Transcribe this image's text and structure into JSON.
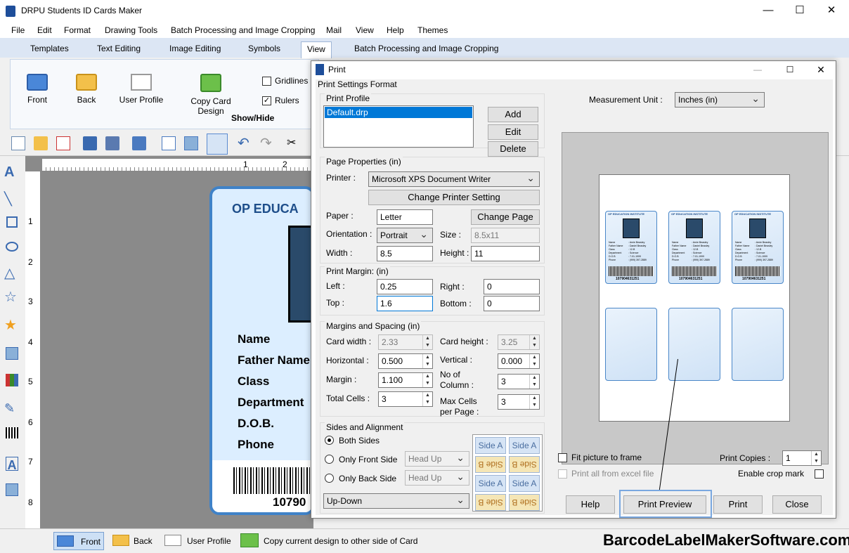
{
  "app": {
    "title": "DRPU Students ID Cards Maker"
  },
  "menu": [
    "File",
    "Edit",
    "Format",
    "Drawing Tools",
    "Batch Processing and Image Cropping",
    "Mail",
    "View",
    "Help",
    "Themes"
  ],
  "tabs": [
    "Templates",
    "Text Editing",
    "Image Editing",
    "Symbols",
    "View",
    "Batch Processing and Image Cropping"
  ],
  "ribbon": {
    "buttons": [
      "Front",
      "Back",
      "User Profile",
      "Copy Card Design"
    ],
    "gridlines": "Gridlines",
    "rulers": "Rulers",
    "group": "Show/Hide",
    "gridlines_checked": false,
    "rulers_checked": true
  },
  "ruler": {
    "top": [
      "1",
      "2"
    ],
    "left": [
      "1",
      "2",
      "3",
      "4",
      "5",
      "6",
      "7",
      "8"
    ]
  },
  "card": {
    "header": "OP EDUCA",
    "fields": [
      "Name",
      "Father Name",
      "Class",
      "Department",
      "D.O.B.",
      "Phone"
    ],
    "barcode_text": "10790"
  },
  "status": {
    "front": "Front",
    "back": "Back",
    "user_profile": "User Profile",
    "copy": "Copy current design to other side of Card"
  },
  "watermark": "BarcodeLabelMakerSoftware.com",
  "dialog": {
    "title": "Print",
    "section": "Print Settings Format",
    "print_profile": {
      "label": "Print Profile",
      "selected": "Default.drp",
      "add": "Add",
      "edit": "Edit",
      "delete": "Delete"
    },
    "page_properties": {
      "label": "Page Properties  (in)",
      "printer_label": "Printer :",
      "printer": "Microsoft XPS Document Writer",
      "change_printer": "Change Printer Setting",
      "paper_label": "Paper :",
      "paper": "Letter",
      "change_page": "Change Page",
      "orientation_label": "Orientation :",
      "orientation": "Portrait",
      "size_label": "Size :",
      "size": "8.5x11",
      "width_label": "Width :",
      "width": "8.5",
      "height_label": "Height :",
      "height": "11"
    },
    "print_margin": {
      "label": "Print Margin: (in)",
      "left_label": "Left :",
      "left": "0.25",
      "right_label": "Right :",
      "right": "0",
      "top_label": "Top :",
      "top": "1.6",
      "bottom_label": "Bottom :",
      "bottom": "0"
    },
    "margins_spacing": {
      "label": "Margins and Spacing  (in)",
      "card_width_label": "Card width :",
      "card_width": "2.33",
      "card_height_label": "Card height :",
      "card_height": "3.25",
      "horizontal_label": "Horizontal :",
      "horizontal": "0.500",
      "vertical_label": "Vertical :",
      "vertical": "0.000",
      "margin_label": "Margin :",
      "margin": "1.100",
      "no_column_label": "No of Column :",
      "no_column": "3",
      "total_cells_label": "Total Cells :",
      "total_cells": "3",
      "max_cells_label": "Max Cells per Page :",
      "max_cells": "3"
    },
    "sides": {
      "label": "Sides and Alignment",
      "both": "Both Sides",
      "front_only": "Only Front Side",
      "back_only": "Only Back Side",
      "head_up": "Head Up",
      "order": "Up-Down",
      "side_a": "Side A",
      "side_b": "Side B"
    },
    "measurement_label": "Measurement Unit :",
    "measurement": "Inches (in)",
    "fit_picture": "Fit picture to frame",
    "print_excel": "Print all from excel file",
    "copies_label": "Print Copies :",
    "copies": "1",
    "crop_mark": "Enable crop mark",
    "buttons": {
      "help": "Help",
      "preview": "Print Preview",
      "print": "Print",
      "close": "Close"
    }
  },
  "preview_card": {
    "institute": "OP EDUCATION INSTITUTE",
    "rows": [
      "Name",
      "Father Name",
      "Class",
      "Department",
      "D.O.B",
      "Phone"
    ],
    "values": [
      "Arnie Beasley",
      "Daniel Beasley",
      "12-B",
      "Science",
      "7-01-1999",
      "(999) 397-2889"
    ],
    "barcode": "107904631251"
  }
}
